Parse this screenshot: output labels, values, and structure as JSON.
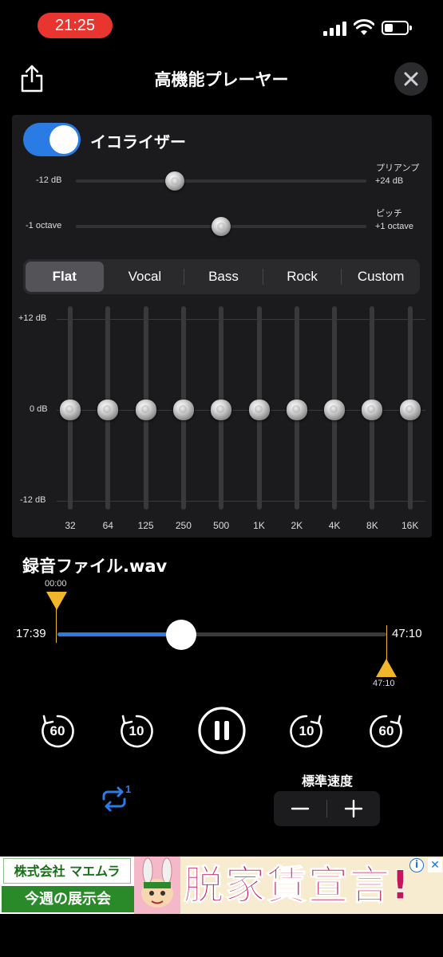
{
  "status": {
    "time": "21:25"
  },
  "header": {
    "title": "高機能プレーヤー"
  },
  "equalizer": {
    "label": "イコライザー",
    "enabled": true,
    "preamp": {
      "left": "-12 dB",
      "right_title": "プリアンプ",
      "right_value": "+24 dB",
      "value_fraction": 0.34
    },
    "pitch": {
      "left": "-1 octave",
      "right_title": "ピッチ",
      "right_value": "+1 octave",
      "value_fraction": 0.5
    },
    "presets": [
      "Flat",
      "Vocal",
      "Bass",
      "Rock",
      "Custom"
    ],
    "selected_preset": "Flat",
    "db_labels": {
      "top": "+12 dB",
      "mid": "0 dB",
      "bottom": "-12 dB"
    },
    "bands": [
      "32",
      "64",
      "125",
      "250",
      "500",
      "1K",
      "2K",
      "4K",
      "8K",
      "16K"
    ],
    "band_gains_db": [
      0,
      0,
      0,
      0,
      0,
      0,
      0,
      0,
      0,
      0
    ]
  },
  "player": {
    "file_name": "録音ファイル.wav",
    "marker_start": "00:00",
    "marker_end": "47:10",
    "current_time": "17:39",
    "total_time": "47:10",
    "progress_fraction": 0.375,
    "speed_label": "標準速度",
    "skip_back_60": "60",
    "skip_back_10": "10",
    "skip_fwd_10": "10",
    "skip_fwd_60": "60",
    "repeat_badge": "1"
  },
  "ad": {
    "company": "株式会社 マエムラ",
    "subtitle": "今週の展示会",
    "headline": "脱家賃宣言!",
    "info": "i",
    "close": "✕"
  },
  "colors": {
    "accent": "#2b7be4",
    "marker": "#f2b62a",
    "status_pill": "#e8352f"
  }
}
